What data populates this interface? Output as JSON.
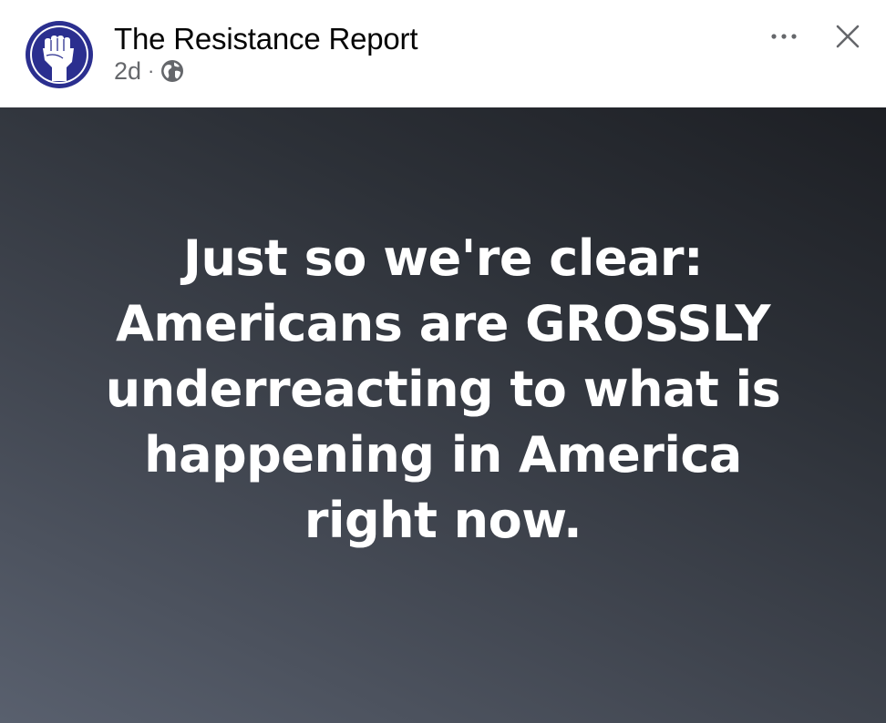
{
  "post": {
    "page_name": "The Resistance Report",
    "time": "2d",
    "separator": "·",
    "privacy_icon": "globe-icon",
    "more_icon": "ellipsis-icon",
    "close_icon": "close-icon",
    "avatar_icon": "raised-fist-icon",
    "text_lines": [
      "Just so we're clear:",
      "Americans are GROSSLY",
      "underreacting to what is",
      "happening in America",
      "right now."
    ]
  },
  "colors": {
    "avatar_blue": "#2b2f8f",
    "name_text": "#050505",
    "meta_text": "#65676b",
    "post_text": "#ffffff"
  }
}
